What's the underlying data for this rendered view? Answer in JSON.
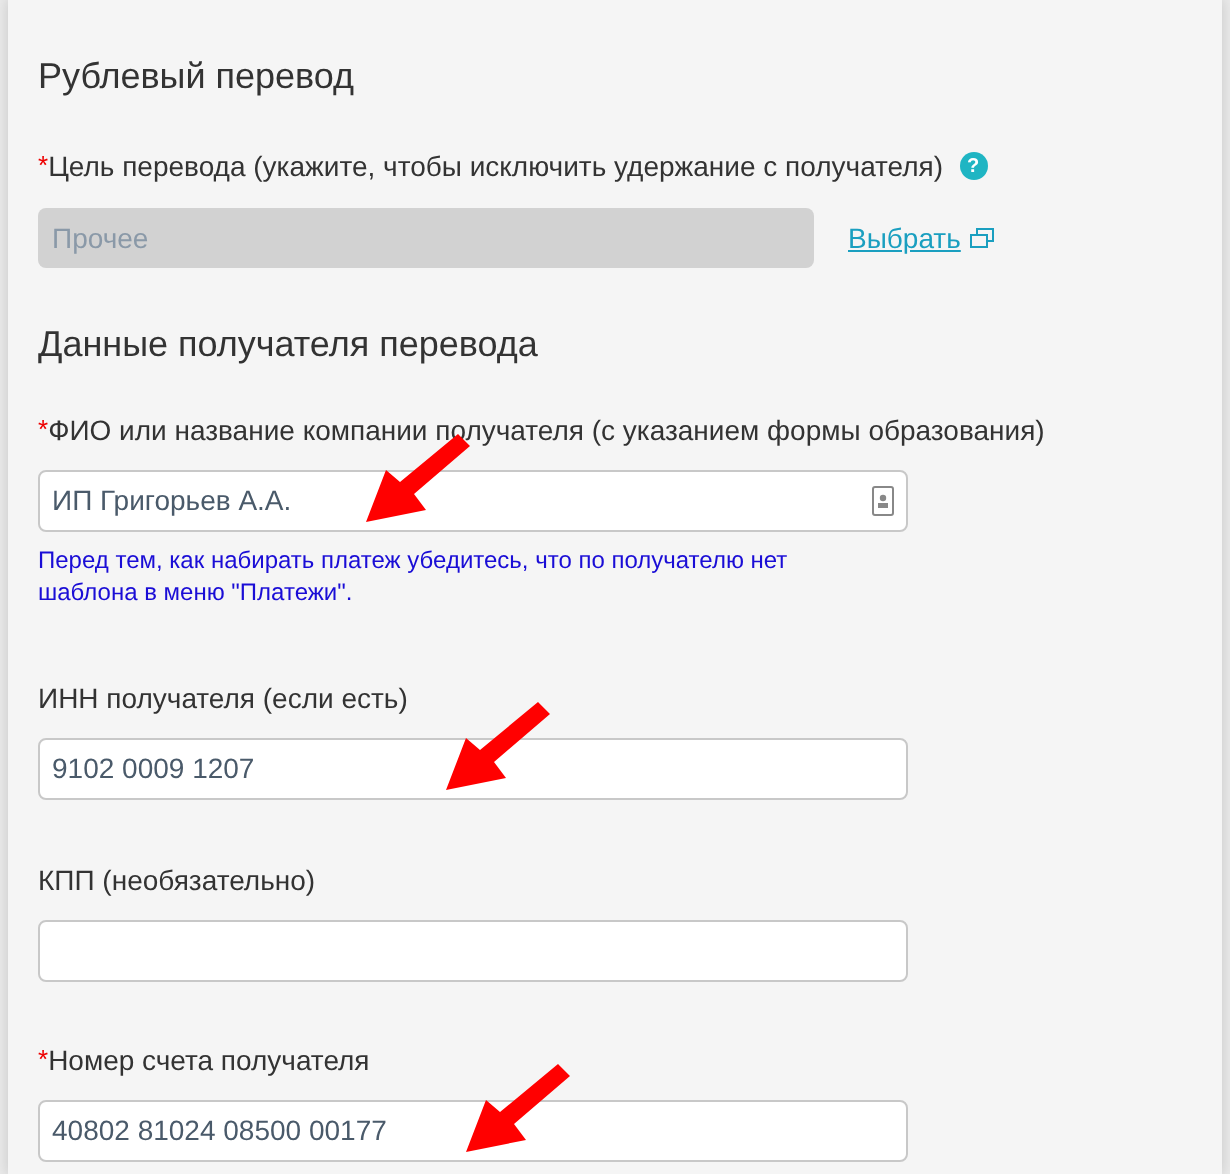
{
  "title": "Рублевый перевод",
  "purpose": {
    "mark": "*",
    "label": "Цель перевода (укажите, чтобы исключить удержание с получателя)",
    "help_icon": "?",
    "value": "Прочее",
    "disabled": true,
    "link": "Выбрать"
  },
  "section_title": "Данные получателя перевода",
  "fields": [
    {
      "mark": "*",
      "label": "ФИО или название компании получателя (с указанием формы образования)",
      "value": "ИП Григорьев А.А.",
      "contact_button": true,
      "hint": "Перед тем, как набирать платеж убедитесь, что по получателю нет шаблона в меню \"Платежи\".",
      "arrow": true
    },
    {
      "label": "ИНН получателя (если есть)",
      "value": "9102 0009 1207",
      "contact_button": false,
      "arrow": true
    },
    {
      "label": "КПП (необязательно)",
      "contact_button": false,
      "arrow": false
    },
    {
      "mark": "*",
      "label": "Номер счета получателя",
      "value": "40802 81024 08500 00177",
      "contact_button": false,
      "arrow": true
    }
  ]
}
